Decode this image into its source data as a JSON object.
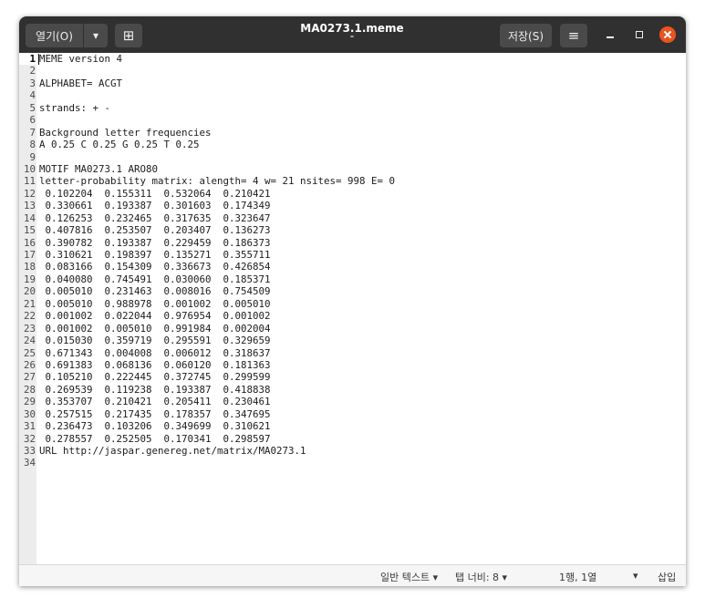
{
  "header": {
    "open_label": "열기(O)",
    "open_dropdown_icon": "▾",
    "new_tab_icon": "⊞",
    "title": "MA0273.1.meme",
    "save_label": "저장(S)",
    "menu_icon": "≡"
  },
  "editor": {
    "lines": [
      "MEME version 4",
      "",
      "ALPHABET= ACGT",
      "",
      "strands: + -",
      "",
      "Background letter frequencies",
      "A 0.25 C 0.25 G 0.25 T 0.25",
      "",
      "MOTIF MA0273.1 ARO80",
      "letter-probability matrix: alength= 4 w= 21 nsites= 998 E= 0",
      " 0.102204  0.155311  0.532064  0.210421",
      " 0.330661  0.193387  0.301603  0.174349",
      " 0.126253  0.232465  0.317635  0.323647",
      " 0.407816  0.253507  0.203407  0.136273",
      " 0.390782  0.193387  0.229459  0.186373",
      " 0.310621  0.198397  0.135271  0.355711",
      " 0.083166  0.154309  0.336673  0.426854",
      " 0.040080  0.745491  0.030060  0.185371",
      " 0.005010  0.231463  0.008016  0.754509",
      " 0.005010  0.988978  0.001002  0.005010",
      " 0.001002  0.022044  0.976954  0.001002",
      " 0.001002  0.005010  0.991984  0.002004",
      " 0.015030  0.359719  0.295591  0.329659",
      " 0.671343  0.004008  0.006012  0.318637",
      " 0.691383  0.068136  0.060120  0.181363",
      " 0.105210  0.222445  0.372745  0.299599",
      " 0.269539  0.119238  0.193387  0.418838",
      " 0.353707  0.210421  0.205411  0.230461",
      " 0.257515  0.217435  0.178357  0.347695",
      " 0.236473  0.103206  0.349699  0.310621",
      " 0.278557  0.252505  0.170341  0.298597",
      "URL http://jaspar.genereg.net/matrix/MA0273.1",
      ""
    ]
  },
  "status": {
    "language": "일반 텍스트 ▾",
    "tab_width": "탭 너비: 8 ▾",
    "position": "1행, 1열",
    "overwrite_arrow": "▾",
    "insert_mode": "삽입"
  }
}
